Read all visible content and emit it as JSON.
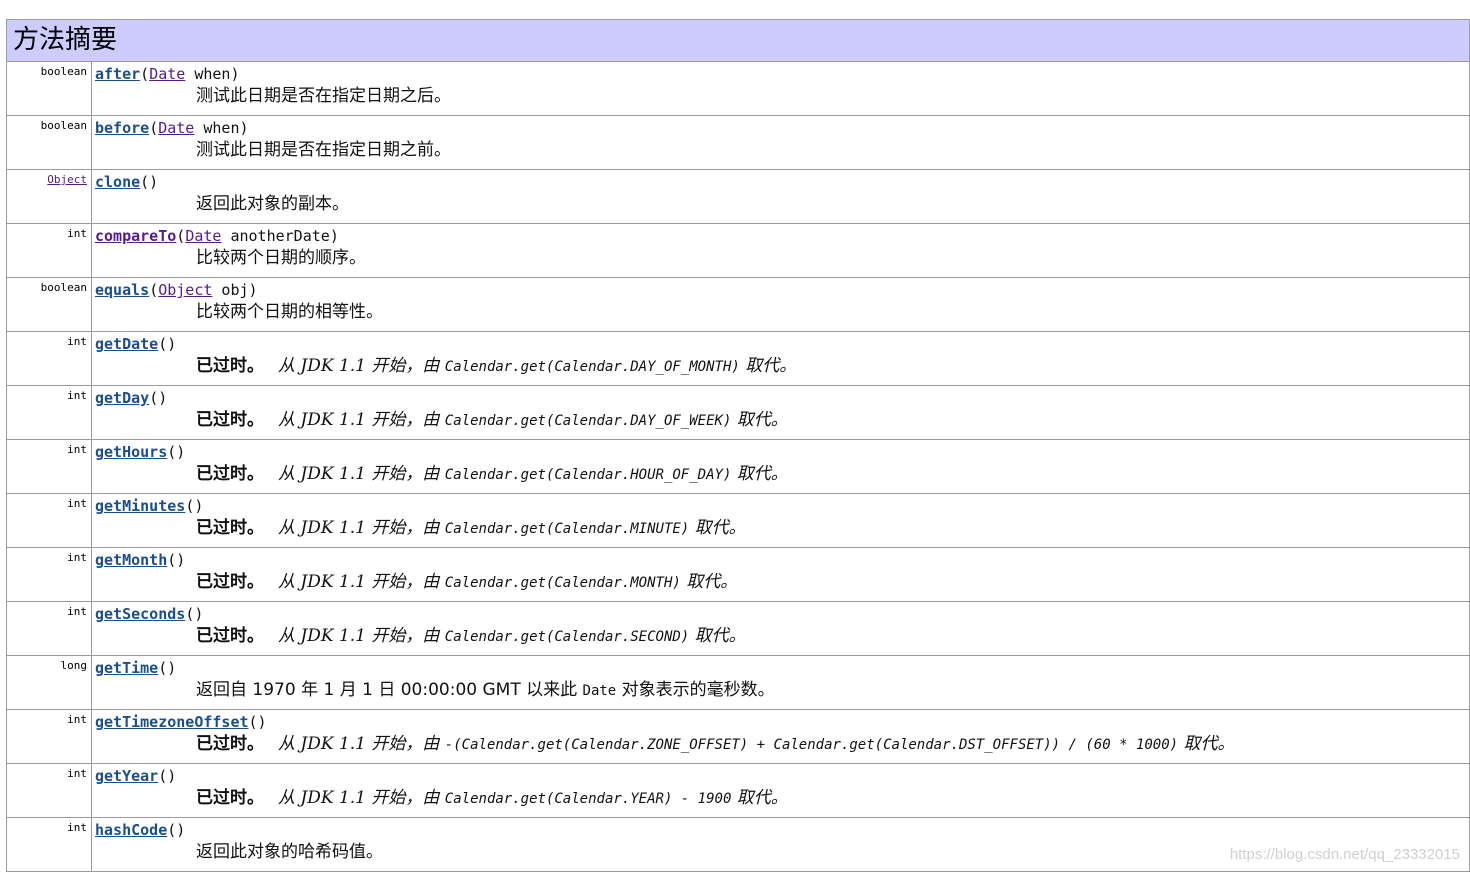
{
  "header": {
    "title": "方法摘要"
  },
  "methods": [
    {
      "ret": "boolean",
      "ret_link": false,
      "name": "after",
      "open": "(",
      "ptype": "Date",
      "pname": " when",
      "close": ")",
      "desc": {
        "deprecated": false,
        "text": "测试此日期是否在指定日期之后。"
      }
    },
    {
      "ret": "boolean",
      "ret_link": false,
      "name": "before",
      "open": "(",
      "ptype": "Date",
      "pname": " when",
      "close": ")",
      "desc": {
        "deprecated": false,
        "text": "测试此日期是否在指定日期之前。"
      }
    },
    {
      "ret": "Object",
      "ret_link": true,
      "name": "clone",
      "open": "()",
      "ptype": "",
      "pname": "",
      "close": "",
      "desc": {
        "deprecated": false,
        "text": "返回此对象的副本。"
      }
    },
    {
      "ret": "int",
      "ret_link": false,
      "name": "compareTo",
      "visited": true,
      "open": "(",
      "ptype": "Date",
      "pname": " anotherDate",
      "close": ")",
      "desc": {
        "deprecated": false,
        "text": "比较两个日期的顺序。"
      }
    },
    {
      "ret": "boolean",
      "ret_link": false,
      "name": "equals",
      "open": "(",
      "ptype": "Object",
      "pname": " obj",
      "close": ")",
      "desc": {
        "deprecated": false,
        "text": "比较两个日期的相等性。"
      }
    },
    {
      "ret": "int",
      "ret_link": false,
      "name": "getDate",
      "open": "()",
      "ptype": "",
      "pname": "",
      "close": "",
      "desc": {
        "deprecated": true,
        "label": "已过时。",
        "pre": "从 JDK 1.1 开始，由 ",
        "code": "Calendar.get(Calendar.DAY_OF_MONTH)",
        "post": " 取代。"
      }
    },
    {
      "ret": "int",
      "ret_link": false,
      "name": "getDay",
      "open": "()",
      "ptype": "",
      "pname": "",
      "close": "",
      "desc": {
        "deprecated": true,
        "label": "已过时。",
        "pre": "从 JDK 1.1 开始，由 ",
        "code": "Calendar.get(Calendar.DAY_OF_WEEK)",
        "post": " 取代。"
      }
    },
    {
      "ret": "int",
      "ret_link": false,
      "name": "getHours",
      "open": "()",
      "ptype": "",
      "pname": "",
      "close": "",
      "desc": {
        "deprecated": true,
        "label": "已过时。",
        "pre": "从 JDK 1.1 开始，由 ",
        "code": "Calendar.get(Calendar.HOUR_OF_DAY)",
        "post": " 取代。"
      }
    },
    {
      "ret": "int",
      "ret_link": false,
      "name": "getMinutes",
      "open": "()",
      "ptype": "",
      "pname": "",
      "close": "",
      "desc": {
        "deprecated": true,
        "label": "已过时。",
        "pre": "从 JDK 1.1 开始，由 ",
        "code": "Calendar.get(Calendar.MINUTE)",
        "post": " 取代。"
      }
    },
    {
      "ret": "int",
      "ret_link": false,
      "name": "getMonth",
      "open": "()",
      "ptype": "",
      "pname": "",
      "close": "",
      "desc": {
        "deprecated": true,
        "label": "已过时。",
        "pre": "从 JDK 1.1 开始，由 ",
        "code": "Calendar.get(Calendar.MONTH)",
        "post": " 取代。"
      }
    },
    {
      "ret": "int",
      "ret_link": false,
      "name": "getSeconds",
      "open": "()",
      "ptype": "",
      "pname": "",
      "close": "",
      "desc": {
        "deprecated": true,
        "label": "已过时。",
        "pre": "从 JDK 1.1 开始，由 ",
        "code": "Calendar.get(Calendar.SECOND)",
        "post": " 取代。"
      }
    },
    {
      "ret": "long",
      "ret_link": false,
      "name": "getTime",
      "open": "()",
      "ptype": "",
      "pname": "",
      "close": "",
      "desc": {
        "deprecated": false,
        "text": "返回自 1970 年 1 月 1 日 00:00:00 GMT 以来此 ",
        "code": "Date",
        "post": " 对象表示的毫秒数。"
      }
    },
    {
      "ret": "int",
      "ret_link": false,
      "name": "getTimezoneOffset",
      "open": "()",
      "ptype": "",
      "pname": "",
      "close": "",
      "desc": {
        "deprecated": true,
        "label": "已过时。",
        "pre": "从 JDK 1.1 开始，由 ",
        "code": "-(Calendar.get(Calendar.ZONE_OFFSET) + Calendar.get(Calendar.DST_OFFSET)) / (60 * 1000)",
        "post": " 取代。"
      }
    },
    {
      "ret": "int",
      "ret_link": false,
      "name": "getYear",
      "open": "()",
      "ptype": "",
      "pname": "",
      "close": "",
      "desc": {
        "deprecated": true,
        "label": "已过时。",
        "pre": "从 JDK 1.1 开始，由 ",
        "code": "Calendar.get(Calendar.YEAR) - 1900",
        "post": " 取代。"
      }
    },
    {
      "ret": "int",
      "ret_link": false,
      "name": "hashCode",
      "open": "()",
      "ptype": "",
      "pname": "",
      "close": "",
      "desc": {
        "deprecated": false,
        "text": "返回此对象的哈希码值。"
      }
    }
  ],
  "watermark": "https://blog.csdn.net/qq_23332015"
}
